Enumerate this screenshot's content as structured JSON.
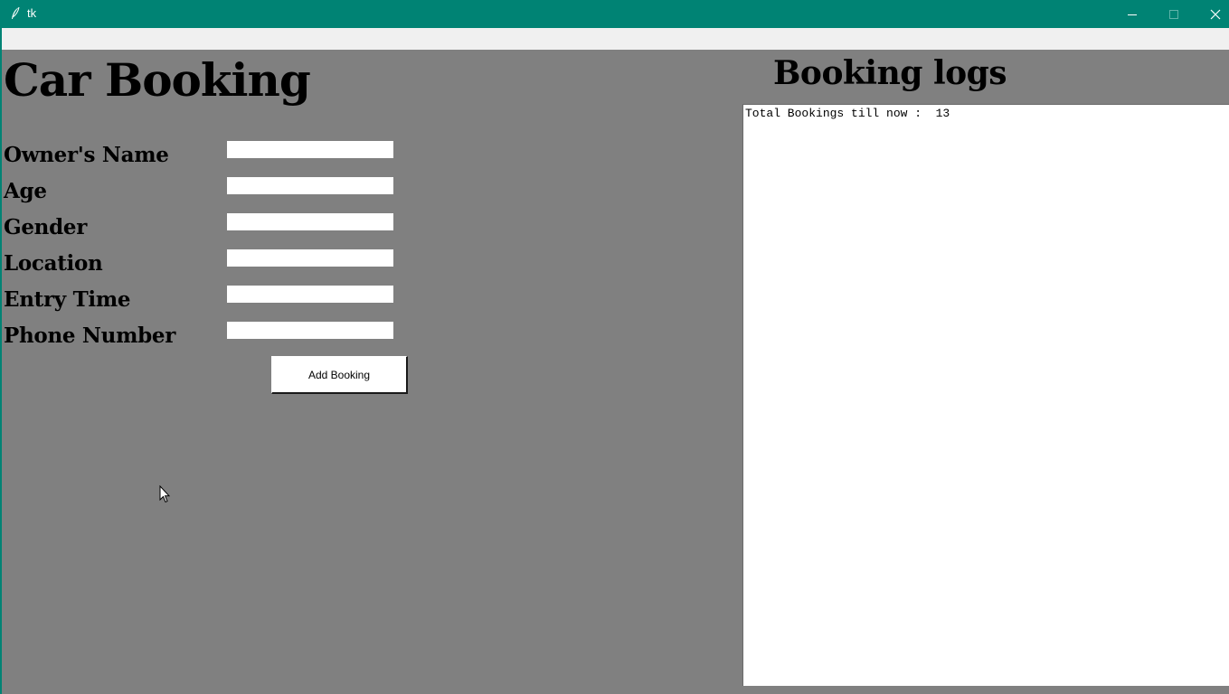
{
  "window": {
    "title": "tk",
    "titlebar_color": "#008374",
    "background_color": "#808080",
    "icons": {
      "app": "feather-icon",
      "minimize": "minimize-icon",
      "maximize": "maximize-icon",
      "close": "close-icon"
    }
  },
  "booking_form": {
    "heading": "Car Booking",
    "fields": [
      {
        "label": "Owner's Name",
        "value": ""
      },
      {
        "label": "Age",
        "value": ""
      },
      {
        "label": "Gender",
        "value": ""
      },
      {
        "label": "Location",
        "value": ""
      },
      {
        "label": "Entry Time",
        "value": ""
      },
      {
        "label": "Phone Number",
        "value": ""
      }
    ],
    "submit_label": "Add Booking"
  },
  "logs": {
    "heading": "Booking logs",
    "text": "Total Bookings till now :  13"
  }
}
